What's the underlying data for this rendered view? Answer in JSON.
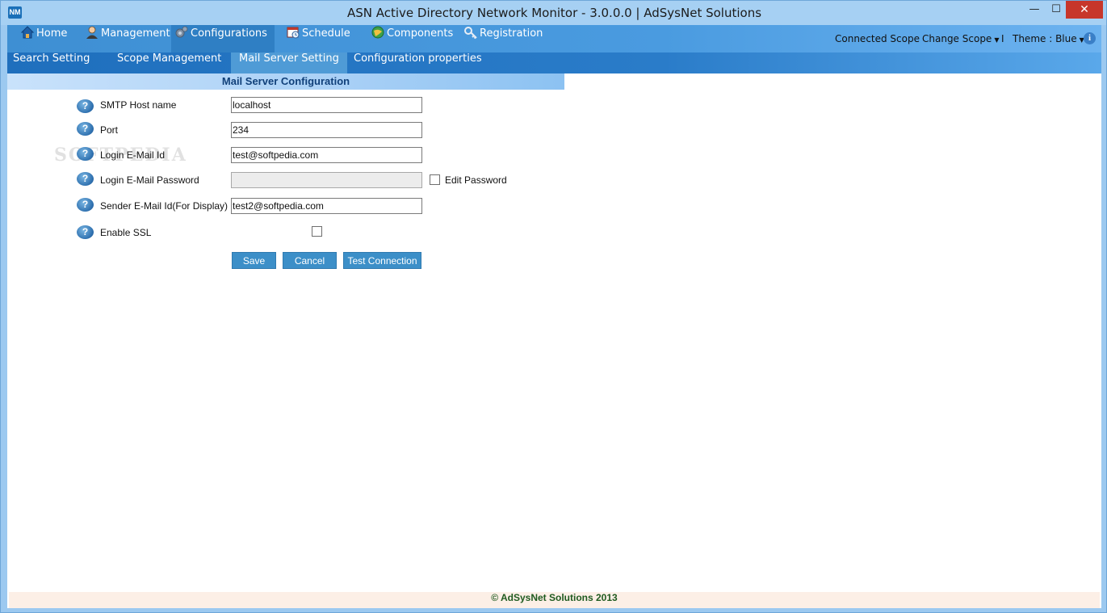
{
  "window": {
    "title": "ASN Active Directory Network Monitor - 3.0.0.0 | AdSysNet Solutions",
    "app_icon_text": "NM",
    "minimize_glyph": "—",
    "maximize_glyph": "☐",
    "close_glyph": "✕"
  },
  "main_nav": {
    "items": [
      {
        "label": "Home",
        "icon": "home-icon"
      },
      {
        "label": "Management",
        "icon": "user-icon"
      },
      {
        "label": "Configurations",
        "icon": "gears-icon"
      },
      {
        "label": "Schedule",
        "icon": "calendar-clock-icon"
      },
      {
        "label": "Components",
        "icon": "globe-icon"
      },
      {
        "label": "Registration",
        "icon": "key-icon"
      }
    ],
    "active": "Configurations",
    "right": {
      "connected_scope": "Connected Scope",
      "change_scope": "Change Scope",
      "separator": "I",
      "theme": "Theme : Blue",
      "info_glyph": "i"
    }
  },
  "sub_nav": {
    "items": [
      "Search Setting",
      "Scope Management",
      "Mail Server Setting",
      "Configuration properties"
    ],
    "active": "Mail Server Setting"
  },
  "form": {
    "section_title": "Mail Server Configuration",
    "help_glyph": "?",
    "fields": {
      "smtp_host": {
        "label": "SMTP Host name",
        "value": "localhost"
      },
      "port": {
        "label": "Port",
        "value": "234"
      },
      "login_email": {
        "label": "Login E-Mail Id",
        "value": "test@softpedia.com"
      },
      "login_password": {
        "label": "Login E-Mail Password",
        "value": ""
      },
      "sender_email": {
        "label": "Sender E-Mail Id(For Display)",
        "value": "test2@softpedia.com"
      },
      "enable_ssl": {
        "label": "Enable SSL",
        "checked": false
      }
    },
    "edit_password_label": "Edit Password",
    "edit_password_checked": false,
    "buttons": {
      "save": "Save",
      "cancel": "Cancel",
      "test_connection": "Test Connection"
    }
  },
  "footer": {
    "text": "© AdSysNet Solutions 2013"
  },
  "watermark": "SOFTPEDIA",
  "colors": {
    "accent": "#3c8fc8",
    "nav_bg": "#4a9be0",
    "subnav_bg": "#2a7cc9",
    "close_button": "#c7362b",
    "section_title": "#10407a"
  }
}
